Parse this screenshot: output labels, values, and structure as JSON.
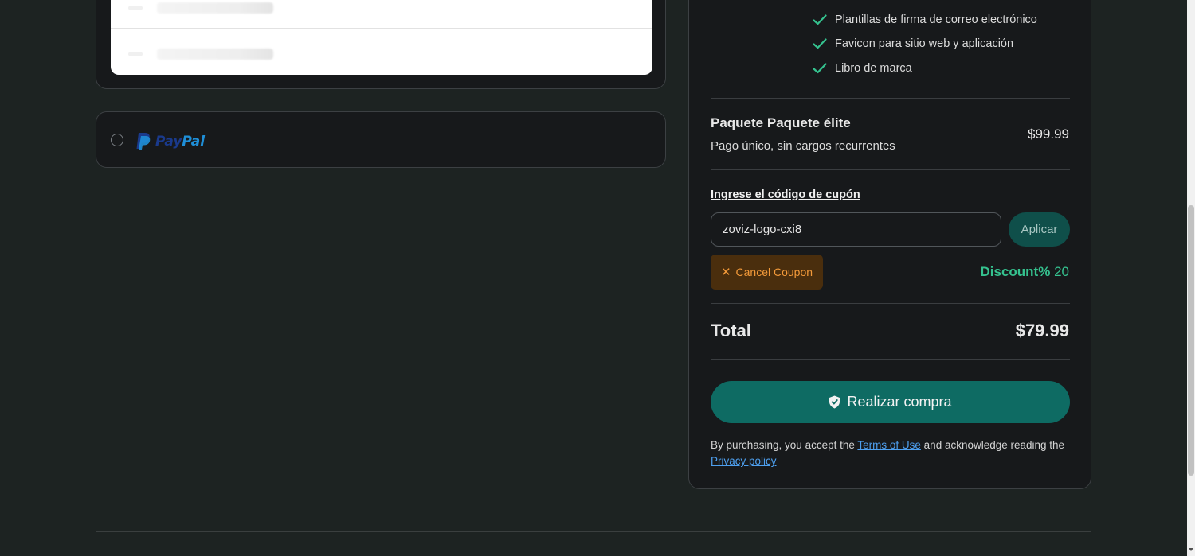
{
  "payment_methods": {
    "paypal": {
      "brand_pay": "Pay",
      "brand_pal": "Pal"
    }
  },
  "summary": {
    "features": [
      "Plantillas de firma de correo electrónico",
      "Favicon para sitio web y aplicación",
      "Libro de marca"
    ],
    "package": {
      "title": "Paquete Paquete élite",
      "subtitle": "Pago único, sin cargos recurrentes",
      "price": "$99.99"
    },
    "coupon": {
      "link_label": "Ingrese el código de cupón",
      "input_value": "zoviz-logo-cxi8",
      "apply_label": "Aplicar",
      "cancel_label": "Cancel Coupon",
      "discount_label": "Discount%",
      "discount_value": "20"
    },
    "total": {
      "label": "Total",
      "value": "$79.99"
    },
    "buy_label": "Realizar compra",
    "legal": {
      "prefix": "By purchasing, you accept the",
      "terms": "Terms of Use",
      "middle": "and acknowledge reading the",
      "privacy": "Privacy policy"
    }
  },
  "colors": {
    "accent": "#0e6b63",
    "check": "#35c28f",
    "discount": "#35c28f",
    "cancel_bg": "#4a2e0d",
    "cancel_fg": "#f39a3a",
    "link": "#4ea0f0"
  },
  "icons": [
    "check-icon",
    "paypal-logo",
    "close-icon",
    "shield-check-icon"
  ]
}
